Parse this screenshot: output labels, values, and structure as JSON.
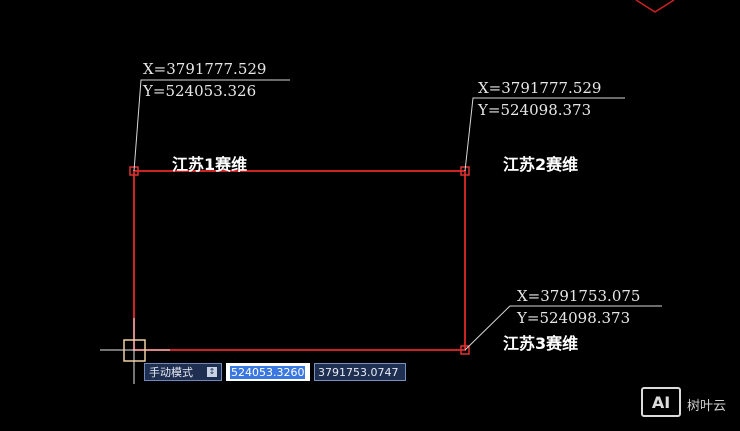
{
  "points": [
    {
      "x_label": "X=3791777.529",
      "y_label": "Y=524053.326",
      "name": "江苏1赛维"
    },
    {
      "x_label": "X=3791777.529",
      "y_label": "Y=524098.373",
      "name": "江苏2赛维"
    },
    {
      "x_label": "X=3791753.075",
      "y_label": "Y=524098.373",
      "name": "江苏3赛维"
    }
  ],
  "dynamic_input": {
    "mode_label": "手动模式",
    "mode_arrow": "↕",
    "value_1": "524053.3260",
    "value_2": "3791753.0747"
  },
  "colors": {
    "boundary": "#cc2222",
    "leader": "#d8d8d8",
    "crosshair": "#e8e8e8",
    "cursor_box": "#f0d0a0"
  },
  "watermark": {
    "logo_text": "AI",
    "site_name": "树叶云"
  }
}
